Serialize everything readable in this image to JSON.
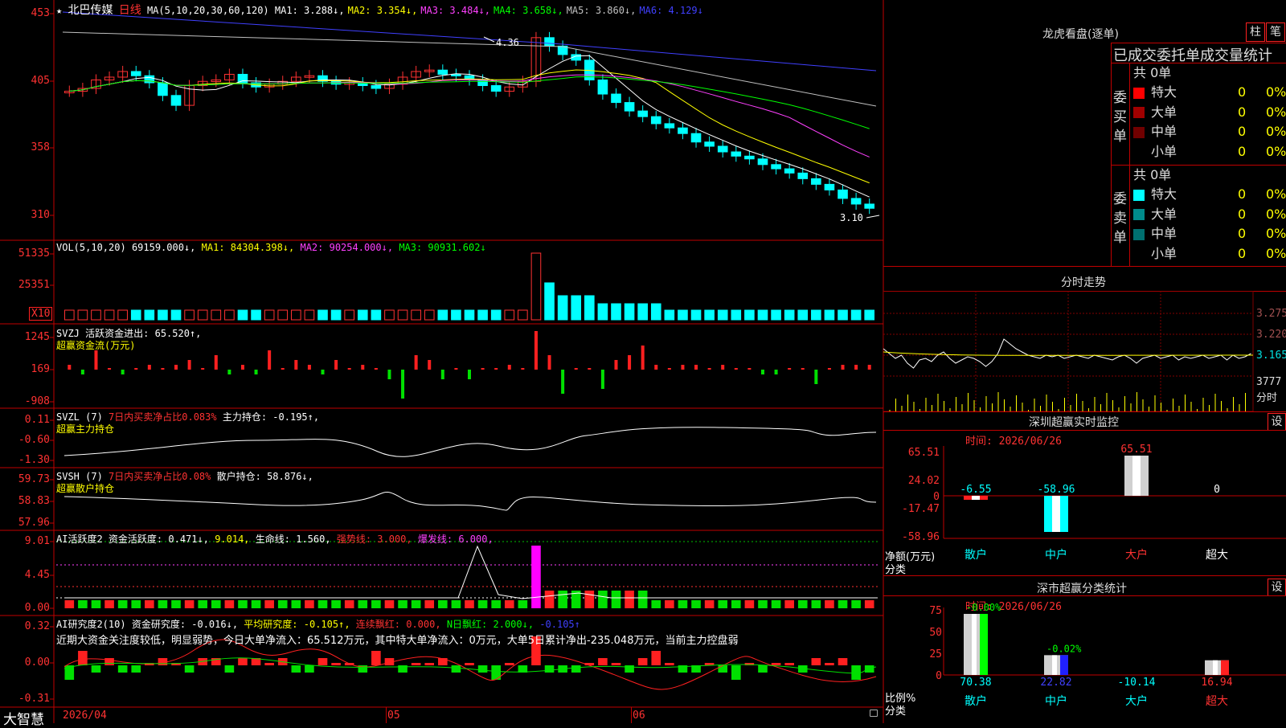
{
  "stock": {
    "title_prefix": "★",
    "name": "北巴传媒",
    "period": "日线",
    "ma_label": "MA(5,10,20,30,60,120)",
    "ma_values": [
      {
        "text": "MA1: 3.288↓,",
        "color": "#ffffff"
      },
      {
        "text": "MA2: 3.354↓,",
        "color": "#ffff00"
      },
      {
        "text": "MA3: 3.484↓,",
        "color": "#ff40ff"
      },
      {
        "text": "MA4: 3.658↓,",
        "color": "#00ff00"
      },
      {
        "text": "MA5: 3.860↓,",
        "color": "#c0c0c0"
      },
      {
        "text": "MA6: 4.129↓",
        "color": "#4040ff"
      }
    ],
    "y_axis": [
      "453",
      "405",
      "358",
      "310"
    ],
    "high_marker": "4.36",
    "low_marker": "3.10"
  },
  "vol": {
    "label": "VOL(5,10,20)",
    "value": "69159.000↓,",
    "ma1": "MA1: 84304.398↓,",
    "ma2": "MA2: 90254.000↓,",
    "ma3": "MA3: 90931.602↓",
    "y_axis": [
      "51335",
      "25351"
    ],
    "unit": "X10"
  },
  "svzj": {
    "line1_label": "SVZJ",
    "line1_text": "活跃资金进出: 65.520↑,",
    "line2_text": "超赢资金流(万元)",
    "y_axis": [
      "1245",
      "169",
      "-908"
    ]
  },
  "svzl": {
    "label": "SVZL (7)",
    "ratio": "7日内买卖净占比0.083%",
    "hold": "主力持仓: -0.195↑,",
    "line2_text": "超赢主力持仓",
    "y_axis": [
      "0.11",
      "-0.60",
      "-1.30"
    ]
  },
  "svsh": {
    "label": "SVSH (7)",
    "ratio": "7日内买卖净占比0.08%",
    "hold": "散户持仓: 58.876↓,",
    "line2_text": "超赢散户持仓",
    "y_axis": [
      "59.73",
      "58.83",
      "57.96"
    ]
  },
  "ai_act": {
    "label": "AI活跃度2",
    "a": "资金活跃度: 0.471↓,",
    "b": "9.014,",
    "c": "生命线: 1.560,",
    "d": "强势线: 3.000,",
    "e": "爆发线: 6.000,",
    "y_axis": [
      "9.01",
      "4.45",
      "0.00"
    ]
  },
  "ai_res": {
    "label": "AI研究度2(10)",
    "a": "资金研究度: -0.016↓,",
    "b": "平均研究度: -0.105↑,",
    "c": "连续飘红: 0.000,",
    "d": "N日飘红: 2.000↓,",
    "e": "-0.105↑",
    "summary": "近期大资金关注度较低，明显弱势，今日大单净流入：65.512万元，其中特大单净流入：0万元，大单5日累计净出-235.048万元，当前主力控盘弱",
    "y_axis": [
      "0.32",
      "0.00",
      "-0.31"
    ]
  },
  "bottom_axis": {
    "brand": "大智慧",
    "date_start": "2026/04",
    "m05": "05",
    "m06": "06"
  },
  "right": {
    "longhu_title": "龙虎看盘(逐单)",
    "btn_zhu": "柱",
    "btn_bi": "笔",
    "stat_title": "已成交委托单成交量统计",
    "buy_label": "委买单",
    "sell_label": "委卖单",
    "buy_total": "共 0单",
    "sell_total": "共 0单",
    "buy_rows": [
      {
        "name": "特大",
        "qty": "0",
        "pct": "0%",
        "color": "#ff0000"
      },
      {
        "name": "大单",
        "qty": "0",
        "pct": "0%",
        "color": "#a00000"
      },
      {
        "name": "中单",
        "qty": "0",
        "pct": "0%",
        "color": "#700000"
      },
      {
        "name": "小单",
        "qty": "0",
        "pct": "0%",
        "color": ""
      }
    ],
    "sell_rows": [
      {
        "name": "特大",
        "qty": "0",
        "pct": "0%",
        "color": "#00ffff"
      },
      {
        "name": "大单",
        "qty": "0",
        "pct": "0%",
        "color": "#008b8b"
      },
      {
        "name": "中单",
        "qty": "0",
        "pct": "0%",
        "color": "#007070"
      },
      {
        "name": "小单",
        "qty": "0",
        "pct": "0%",
        "color": ""
      }
    ],
    "fenshi_title": "分时走势",
    "fenshi_prices": [
      "3.275",
      "3.220",
      "3.165"
    ],
    "fenshi_vol": "3777",
    "fenshi_vol_label": "分时",
    "monitor_title": "深圳超赢实时监控",
    "monitor_btn": "设",
    "monitor_time": "时间: 2026/06/26",
    "monitor_y": [
      "65.51",
      "24.02",
      "0",
      "-17.47",
      "-58.96"
    ],
    "monitor_unit": "净额(万元)",
    "monitor_cat_label": "分类",
    "monitor_bars": [
      {
        "cat": "散户",
        "value": -6.55,
        "label": "-6.55"
      },
      {
        "cat": "中户",
        "value": -58.96,
        "label": "-58.96"
      },
      {
        "cat": "大户",
        "value": 65.51,
        "label": "65.51"
      },
      {
        "cat": "超大",
        "value": 0,
        "label": "0"
      }
    ],
    "classify_title": "深市超赢分类统计",
    "classify_btn": "设",
    "classify_time": "时间: 2026/06/26",
    "classify_y": [
      "75",
      "50",
      "25",
      "0"
    ],
    "classify_unit": "比例%",
    "classify_cat_label": "分类",
    "classify_bars": [
      {
        "cat": "散户",
        "value": 70.38,
        "label": "70.38",
        "top": "-0.00%",
        "color": "#00ff00"
      },
      {
        "cat": "中户",
        "value": 22.82,
        "label": "22.82",
        "top": "-0.02%",
        "color": "#2020ff"
      },
      {
        "cat": "大户",
        "value": -10.14,
        "label": "-10.14",
        "top": "",
        "color": "#00ffff"
      },
      {
        "cat": "超大",
        "value": 16.94,
        "label": "16.94",
        "top": "",
        "color": "#ff2020"
      }
    ]
  }
}
